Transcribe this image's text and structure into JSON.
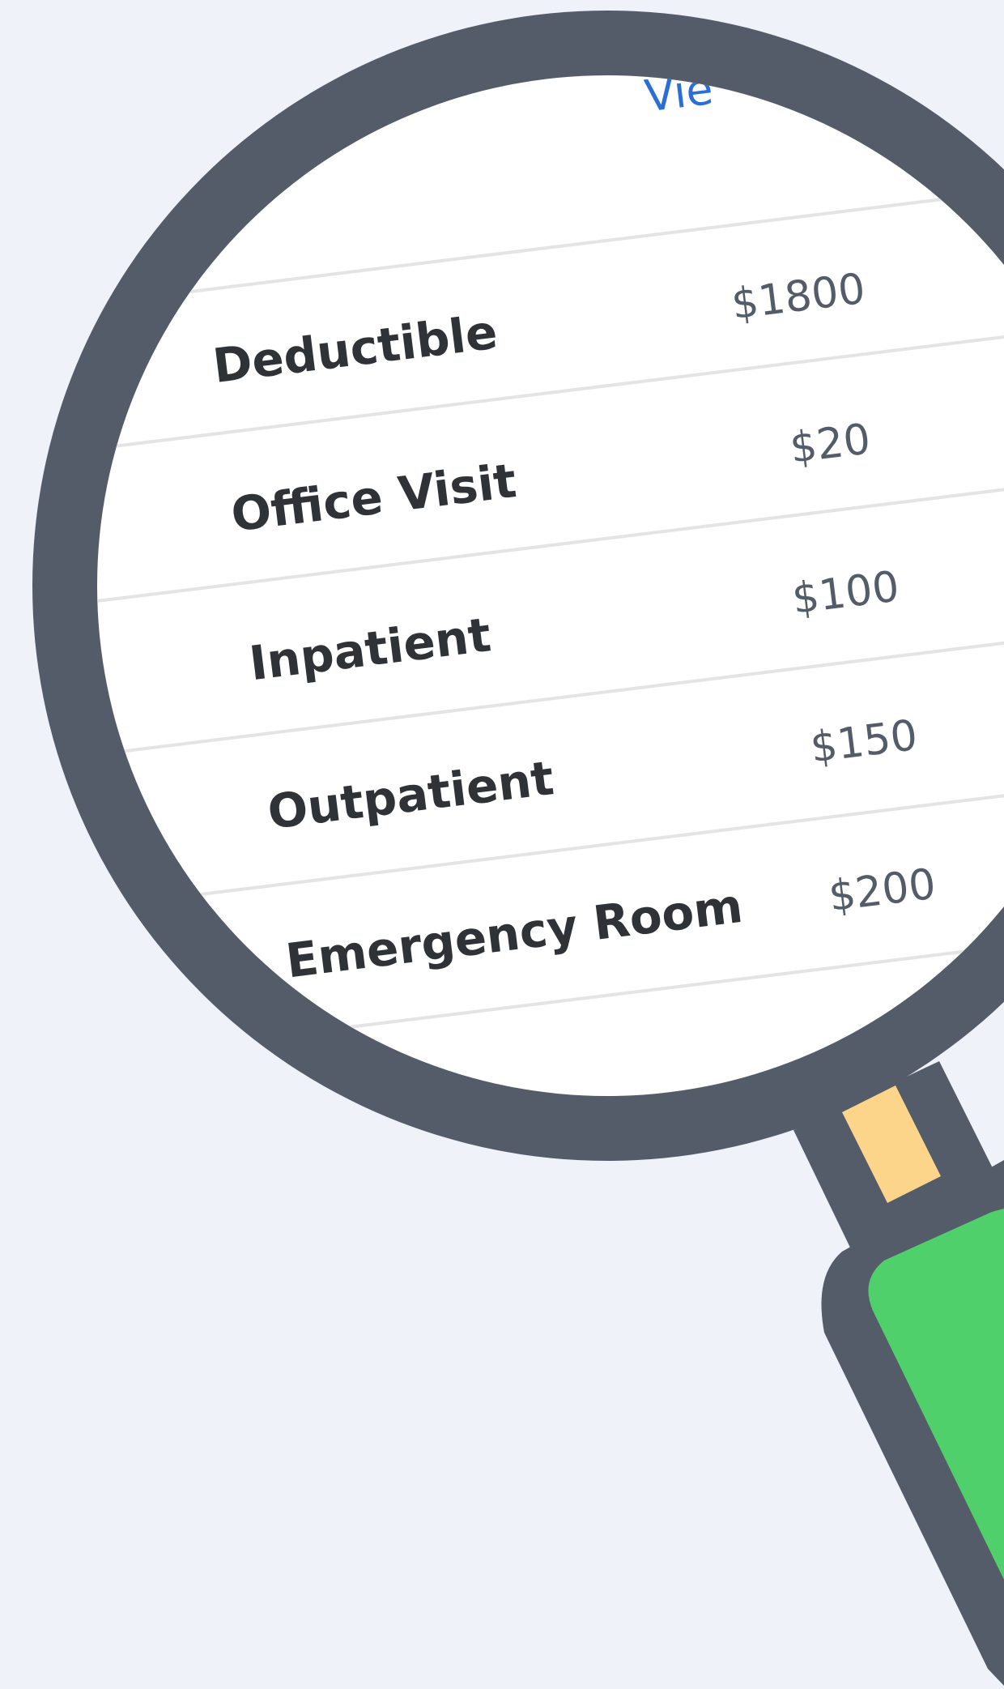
{
  "link": {
    "text": "Vie"
  },
  "benefits": [
    {
      "label": "Deductible",
      "value": "$1800"
    },
    {
      "label": "Office Visit",
      "value": "$20"
    },
    {
      "label": "Inpatient",
      "value": "$100"
    },
    {
      "label": "Outpatient",
      "value": "$150"
    },
    {
      "label": "Emergency Room",
      "value": "$200"
    }
  ],
  "colors": {
    "background": "#f0f2fa",
    "frame": "#555c69",
    "lens": "#ffffff",
    "row_line": "#e4e4e4",
    "label": "#2f3338",
    "value": "#555c69",
    "link": "#2b6fd6",
    "handle": "#50d06a",
    "collar": "#fdd58a"
  },
  "icon": "magnifying-glass-icon"
}
